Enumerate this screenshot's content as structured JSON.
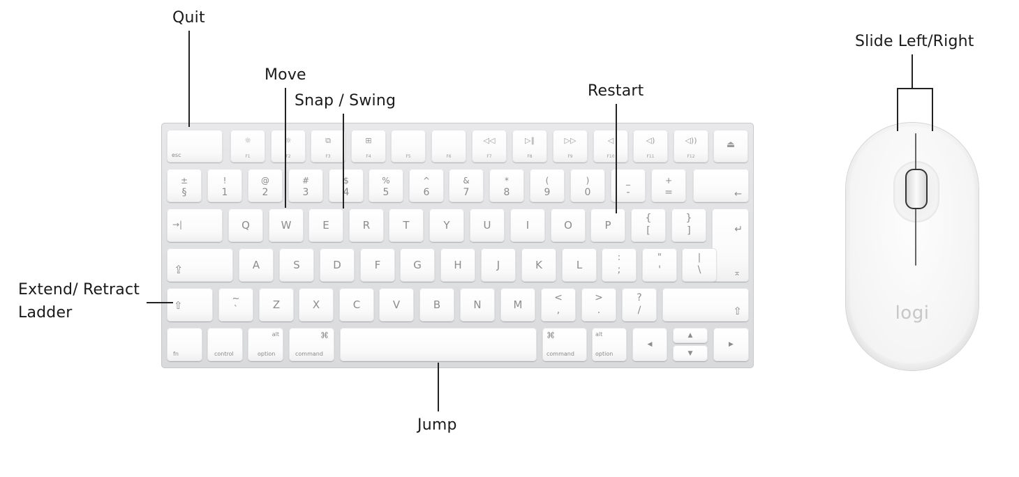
{
  "labels": {
    "quit": "Quit",
    "move": "Move",
    "snap_swing": "Snap / Swing",
    "restart": "Restart",
    "extend_line1": "Extend/ Retract",
    "extend_line2": "Ladder",
    "jump": "Jump",
    "slide": "Slide Left/Right"
  },
  "keyboard": {
    "esc": "esc",
    "function_keys": [
      {
        "icon": "☼",
        "label": "F1"
      },
      {
        "icon": "☼",
        "label": "F2"
      },
      {
        "icon": "⧉",
        "label": "F3"
      },
      {
        "icon": "⊞",
        "label": "F4"
      },
      {
        "icon": "",
        "label": "F5"
      },
      {
        "icon": "",
        "label": "F6"
      },
      {
        "icon": "◁◁",
        "label": "F7"
      },
      {
        "icon": "▷∥",
        "label": "F8"
      },
      {
        "icon": "▷▷",
        "label": "F9"
      },
      {
        "icon": "◁",
        "label": "F10"
      },
      {
        "icon": "◁)",
        "label": "F11"
      },
      {
        "icon": "◁))",
        "label": "F12"
      }
    ],
    "eject": "⏏",
    "number_row": [
      {
        "top": "±",
        "bottom": "§"
      },
      {
        "top": "!",
        "bottom": "1"
      },
      {
        "top": "@",
        "bottom": "2"
      },
      {
        "top": "#",
        "bottom": "3"
      },
      {
        "top": "$",
        "bottom": "4"
      },
      {
        "top": "%",
        "bottom": "5"
      },
      {
        "top": "^",
        "bottom": "6"
      },
      {
        "top": "&",
        "bottom": "7"
      },
      {
        "top": "*",
        "bottom": "8"
      },
      {
        "top": "(",
        "bottom": "9"
      },
      {
        "top": ")",
        "bottom": "0"
      },
      {
        "top": "_",
        "bottom": "-"
      },
      {
        "top": "+",
        "bottom": "="
      }
    ],
    "backspace": "←",
    "tab": "→|",
    "row_q": [
      "Q",
      "W",
      "E",
      "R",
      "T",
      "Y",
      "U",
      "I",
      "O",
      "P"
    ],
    "bracket_keys": [
      {
        "top": "{",
        "bottom": "["
      },
      {
        "top": "}",
        "bottom": "]"
      }
    ],
    "return": "↵",
    "caps": "⇪",
    "row_a": [
      "A",
      "S",
      "D",
      "F",
      "G",
      "H",
      "J",
      "K",
      "L"
    ],
    "punct_a": [
      {
        "top": ":",
        "bottom": ";"
      },
      {
        "top": "\"",
        "bottom": "'"
      },
      {
        "top": "|",
        "bottom": "\\"
      }
    ],
    "return_lower": "⌅",
    "shift": "⇧",
    "tilde": {
      "top": "~",
      "bottom": "`"
    },
    "row_z": [
      "Z",
      "X",
      "C",
      "V",
      "B",
      "N",
      "M"
    ],
    "punct_z": [
      {
        "top": "<",
        "bottom": ","
      },
      {
        "top": ">",
        "bottom": "."
      },
      {
        "top": "?",
        "bottom": "/"
      }
    ],
    "fn": "fn",
    "control": "control",
    "alt": "alt",
    "option": "option",
    "cmd_symbol": "⌘",
    "command": "command",
    "arrow_left": "◀",
    "arrow_up": "▲",
    "arrow_down": "▼",
    "arrow_right": "▶"
  },
  "mouse": {
    "brand": "logi"
  }
}
